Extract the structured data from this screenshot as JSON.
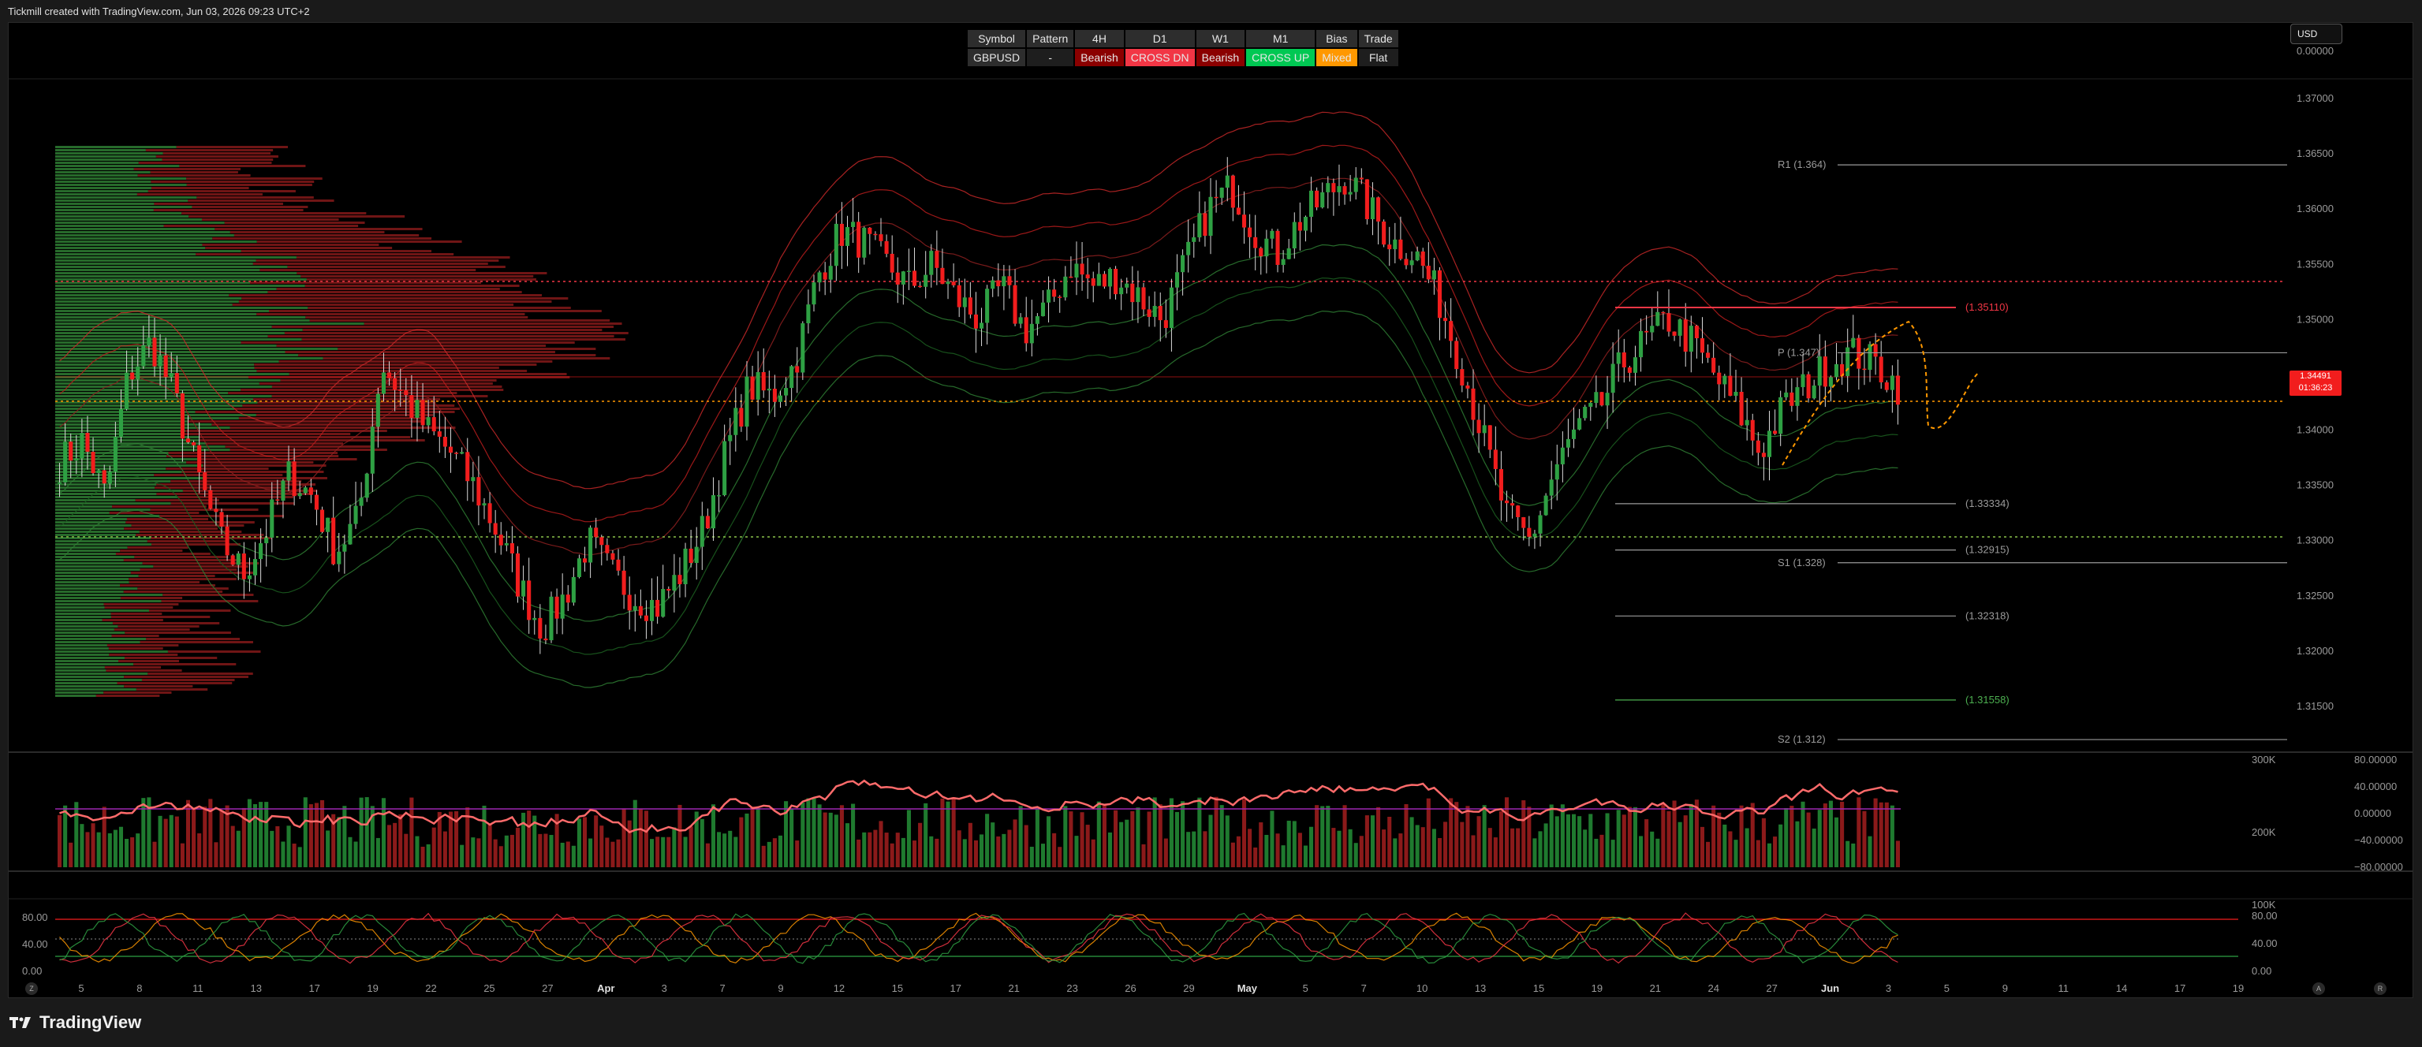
{
  "header": {
    "caption": "Tickmill created with TradingView.com, Jun 03, 2026 09:23 UTC+2"
  },
  "currency": "USD",
  "footer": {
    "brand": "TradingView"
  },
  "info_table": {
    "headers": [
      "Symbol",
      "Pattern",
      "4H",
      "D1",
      "W1",
      "M1",
      "Bias",
      "Trade"
    ],
    "values": [
      "GBPUSD",
      "-",
      "Bearish",
      "CROSS DN",
      "Bearish",
      "CROSS UP",
      "Mixed",
      "Flat"
    ],
    "value_colors": [
      "#2d2d2d",
      "#1e1e1e",
      "#8b0000",
      "#f23645",
      "#8b0000",
      "#00c853",
      "#ff9800",
      "#1e1e1e"
    ]
  },
  "price_axis": {
    "labels": [
      "0.00000",
      "1.37000",
      "1.36500",
      "1.36000",
      "1.35500",
      "1.35000",
      "1.34000",
      "1.33500",
      "1.33000",
      "1.32500",
      "1.32000",
      "1.31500"
    ],
    "current_price": "1.34491",
    "countdown": "01:36:23"
  },
  "levels": [
    {
      "label": "R1 (1.364)",
      "value": 1.364,
      "color": "#9a9a9a"
    },
    {
      "label": "(1.35110)",
      "value": 1.3511,
      "color": "#f23645"
    },
    {
      "label": "P (1.347)",
      "value": 1.347,
      "color": "#9a9a9a"
    },
    {
      "label": "(1.33334)",
      "value": 1.33334,
      "color": "#9a9a9a"
    },
    {
      "label": "(1.32915)",
      "value": 1.32915,
      "color": "#9a9a9a"
    },
    {
      "label": "S1 (1.328)",
      "value": 1.328,
      "color": "#9a9a9a"
    },
    {
      "label": "(1.32318)",
      "value": 1.32318,
      "color": "#9a9a9a"
    },
    {
      "label": "(1.31558)",
      "value": 1.31558,
      "color": "#4caf50"
    },
    {
      "label": "S2 (1.312)",
      "value": 1.312,
      "color": "#9a9a9a"
    }
  ],
  "rsi_axis": {
    "left": [
      "300K",
      "200K",
      "100K"
    ],
    "right": [
      "80.00000",
      "40.00000",
      "0.00000",
      "−40.00000",
      "−80.00000"
    ]
  },
  "stoch_axis": {
    "left": [
      "80.00",
      "40.00",
      "0.00"
    ],
    "right": [
      "80.00",
      "40.00",
      "0.00"
    ]
  },
  "time_axis": [
    "5",
    "8",
    "11",
    "13",
    "17",
    "19",
    "22",
    "25",
    "27",
    "Apr",
    "3",
    "7",
    "9",
    "12",
    "15",
    "17",
    "21",
    "23",
    "26",
    "29",
    "May",
    "5",
    "7",
    "10",
    "13",
    "15",
    "19",
    "21",
    "24",
    "27",
    "Jun",
    "3",
    "5",
    "9",
    "11",
    "14",
    "17",
    "19"
  ],
  "axis_buttons": {
    "left": "Z",
    "right_a": "A",
    "right_b": "R"
  },
  "colors": {
    "up": "#2ea043",
    "down": "#f21d1d",
    "bg": "#000000"
  },
  "chart_data": {
    "type": "candlestick",
    "symbol": "GBPUSD",
    "ylim": [
      1.311,
      1.3715
    ],
    "close_series_estimate": [
      1.337,
      1.339,
      1.334,
      1.345,
      1.348,
      1.343,
      1.336,
      1.33,
      1.327,
      1.331,
      1.336,
      1.334,
      1.329,
      1.332,
      1.346,
      1.343,
      1.34,
      1.338,
      1.335,
      1.331,
      1.326,
      1.322,
      1.325,
      1.33,
      1.327,
      1.325,
      1.324,
      1.327,
      1.331,
      1.338,
      1.344,
      1.343,
      1.346,
      1.354,
      1.358,
      1.357,
      1.355,
      1.353,
      1.355,
      1.352,
      1.35,
      1.353,
      1.349,
      1.351,
      1.355,
      1.353,
      1.354,
      1.352,
      1.35,
      1.355,
      1.36,
      1.362,
      1.358,
      1.356,
      1.359,
      1.361,
      1.363,
      1.36,
      1.357,
      1.356,
      1.352,
      1.346,
      1.339,
      1.332,
      1.33,
      1.336,
      1.34,
      1.342,
      1.346,
      1.348,
      1.35,
      1.348,
      1.345,
      1.342,
      1.338,
      1.342,
      1.344,
      1.346,
      1.347,
      1.346,
      1.344
    ]
  }
}
